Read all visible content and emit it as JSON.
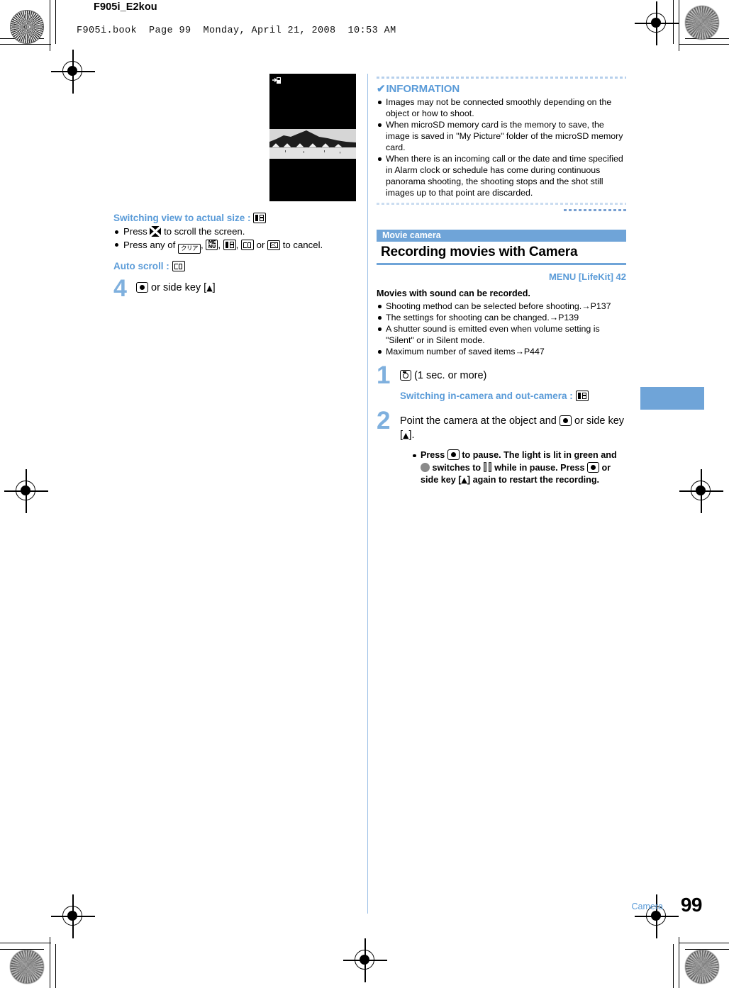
{
  "header": {
    "doc_id": "F905i_E2kou",
    "book_line": "F905i.book  Page 99  Monday, April 21, 2008  10:53 AM"
  },
  "left_column": {
    "screenshot": {
      "caption_icon": "memory-card-save-icon",
      "scene": "grayscale beach panorama with hills and umbrellas on black background"
    },
    "switch_actual_size_label": "Switching view to actual size :",
    "bullets": [
      {
        "pre": "Press",
        "icon": "dpad-icon",
        "post": "to scroll the screen."
      },
      {
        "pre": "Press any of",
        "icons": [
          "clear-key-icon",
          "menu-key-icon",
          "photo-key-icon",
          "book-key-icon",
          "mail-key-icon"
        ],
        "post": "to cancel."
      }
    ],
    "bullet2_text_join": ", ",
    "bullet2_or": "or",
    "auto_scroll_label": "Auto scroll :",
    "step": {
      "number": "4",
      "text_before": "",
      "text_after": "or side key [",
      "side_key_arrow": "▲",
      "text_end": "]"
    }
  },
  "right_column": {
    "information": {
      "title": "INFORMATION",
      "check_glyph": "✔",
      "items": [
        "Images may not be connected smoothly depending on the object or how to shoot.",
        "When microSD memory card is the memory to save, the image is saved in \"My Picture\" folder of the microSD memory card.",
        "When there is an incoming call or the date and time specified in Alarm clock or schedule has come during continuous panorama shooting, the shooting stops and the shot still images up to that point are discarded."
      ]
    },
    "section": {
      "tag": "Movie camera",
      "title": "Recording movies with Camera",
      "menu_line": "MENU [LifeKit] 42",
      "lead": "Movies with sound can be recorded.",
      "lead_bullets": [
        "Shooting method can be selected before shooting.→P137",
        "The settings for shooting can be changed.→P139",
        "A shutter sound is emitted even when volume setting is \"Silent\" or in Silent mode.",
        "Maximum number of saved items→P447"
      ]
    },
    "step1": {
      "number": "1",
      "icon": "camera-key-icon",
      "text": "(1 sec. or more)",
      "sub_label": "Switching in-camera and out-camera :",
      "sub_icon": "photo-key-icon"
    },
    "step2": {
      "number": "2",
      "text_a": "Point the camera at the object and",
      "text_b": "or side key [",
      "arrow": "▲",
      "text_c": "].",
      "bullet": {
        "p1": "Press",
        "p2": "to pause. The light is lit in green and",
        "p3": "switches to",
        "p4": "while in pause. Press",
        "p5": "or side key [",
        "p6": "▲",
        "p7": "] again to restart the recording."
      }
    }
  },
  "footer": {
    "section_name": "Camera",
    "page_number": "99"
  },
  "colors": {
    "accent_blue": "#5a9bd8",
    "band_blue": "#6fa4d8",
    "step_number_blue": "#7fb0de",
    "divider_blue": "#9dc0e6"
  }
}
